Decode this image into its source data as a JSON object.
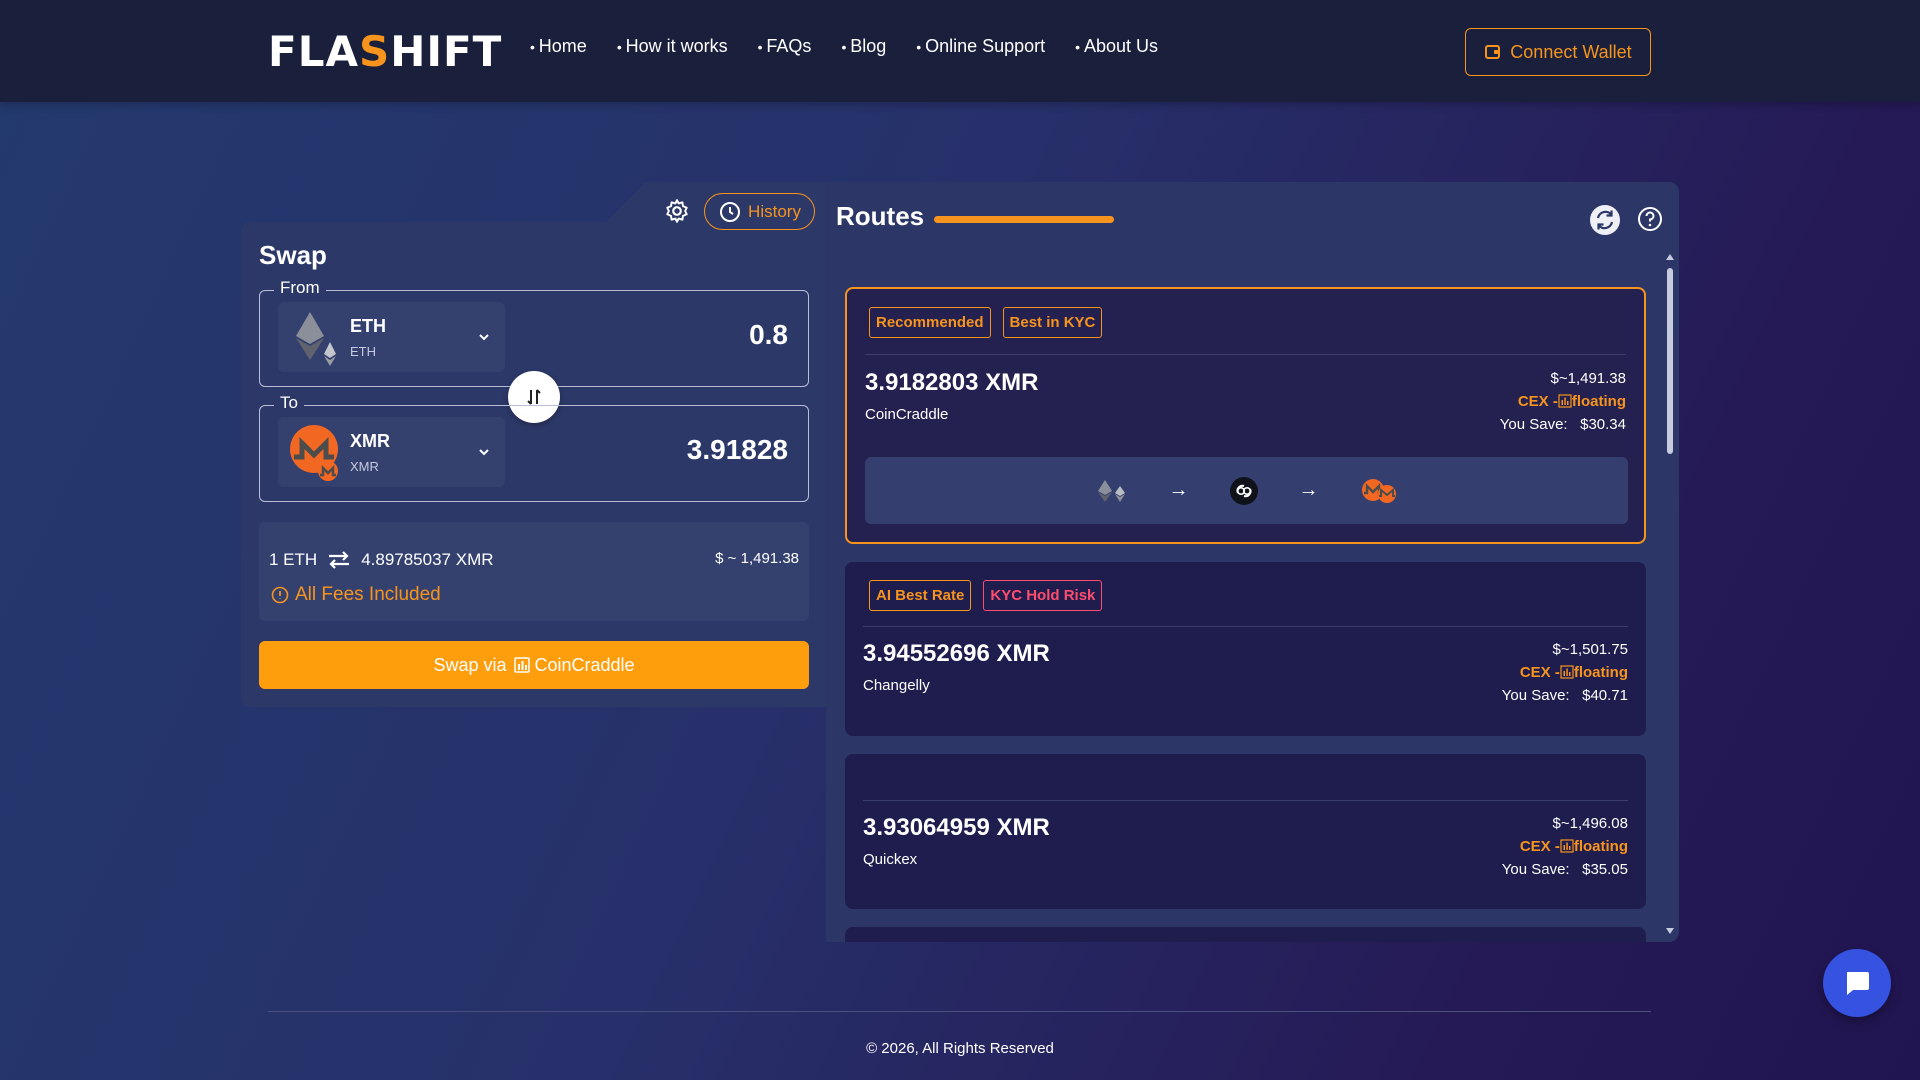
{
  "header": {
    "logo_left": "FLA",
    "logo_accent": "S",
    "logo_right": "HIFT",
    "nav": [
      "Home",
      "How it works",
      "FAQs",
      "Blog",
      "Online Support",
      "About Us"
    ],
    "connect_wallet": "Connect Wallet"
  },
  "swap": {
    "title": "Swap",
    "history_label": "History",
    "from": {
      "label": "From",
      "symbol": "ETH",
      "network": "ETH",
      "amount": "0.8"
    },
    "to": {
      "label": "To",
      "symbol": "XMR",
      "network": "XMR",
      "amount": "3.91828"
    },
    "rate": {
      "base": "1 ETH",
      "quote": "4.89785037 XMR",
      "usd": "$ ~ 1,491.38"
    },
    "fees_note": "All Fees Included",
    "swap_button_prefix": "Swap via",
    "swap_button_provider": "CoinCraddle"
  },
  "routes": {
    "title": "Routes",
    "progress_percent": 100,
    "items": [
      {
        "badges": [
          "Recommended",
          "Best in KYC"
        ],
        "amount": "3.9182803 XMR",
        "provider": "CoinCraddle",
        "usd": "$~1,491.38",
        "type_prefix": "CEX -",
        "type_label": "floating",
        "save_label": "You Save:",
        "save_value": "$30.34"
      },
      {
        "badges": [
          "AI Best Rate",
          "KYC Hold Risk"
        ],
        "amount": "3.94552696 XMR",
        "provider": "Changelly",
        "usd": "$~1,501.75",
        "type_prefix": "CEX -",
        "type_label": "floating",
        "save_label": "You Save:",
        "save_value": "$40.71"
      },
      {
        "badges": [],
        "amount": "3.93064959 XMR",
        "provider": "Quickex",
        "usd": "$~1,496.08",
        "type_prefix": "CEX -",
        "type_label": "floating",
        "save_label": "You Save:",
        "save_value": "$35.05"
      }
    ]
  },
  "footer": {
    "copyright": "© 2026, All Rights Reserved"
  },
  "colors": {
    "accent": "#f7941d",
    "risk": "#ff4d6d",
    "chat": "#3552e0",
    "swap_button": "#ff9e0d"
  }
}
